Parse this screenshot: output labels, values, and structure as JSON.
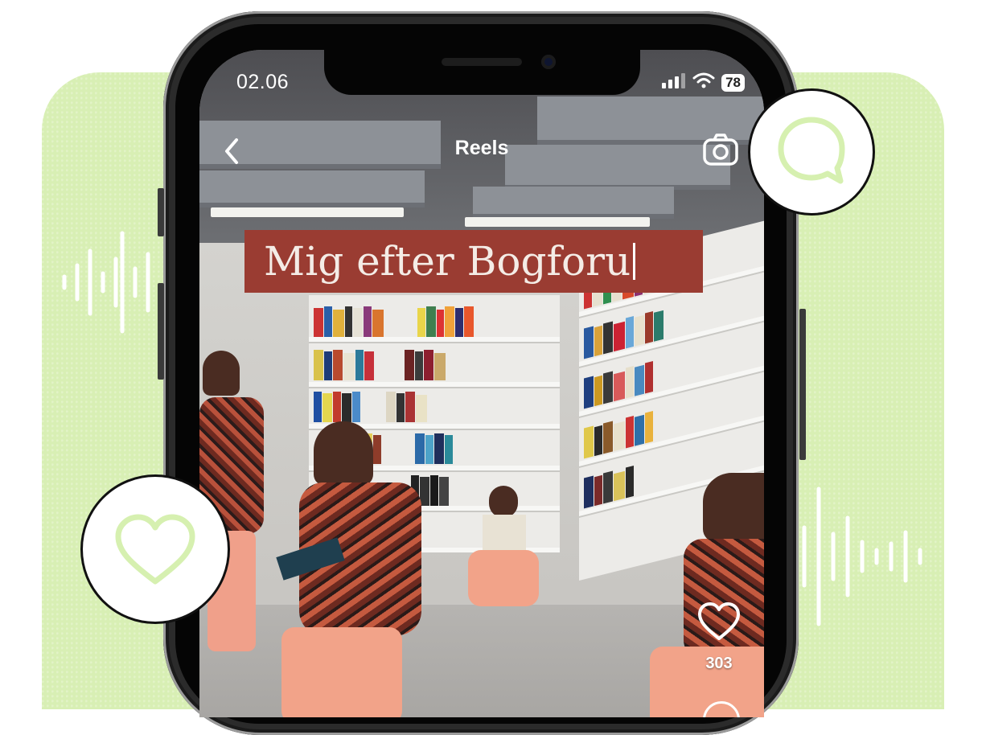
{
  "status_bar": {
    "time": "02.06",
    "battery_level": "78",
    "signal_icon": "cellular-signal-icon",
    "wifi_icon": "wifi-icon"
  },
  "header": {
    "title": "Reels",
    "back_icon": "chevron-left-icon",
    "camera_icon": "camera-icon"
  },
  "reel": {
    "caption_text": "Mig efter Bogforu",
    "likes_count": "303",
    "like_icon": "heart-icon",
    "comment_icon": "comment-icon"
  },
  "floating_icons": {
    "chat": "chat-bubble-icon",
    "heart": "heart-icon",
    "sound_left": "sound-wave-icon",
    "sound_right": "sound-wave-icon"
  },
  "colors": {
    "backdrop": "#d8efb4",
    "accent_green": "#d6f0b0",
    "caption_bg": "#9a3c32"
  }
}
